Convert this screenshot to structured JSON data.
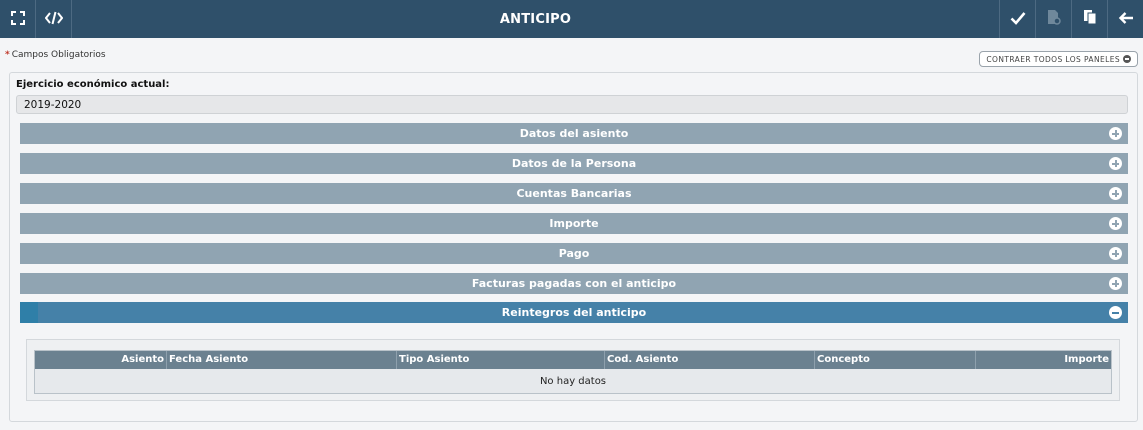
{
  "topbar": {
    "title": "ANTICIPO",
    "left_icons": [
      "fullscreen-icon",
      "code-icon"
    ],
    "right_icons": [
      "check-icon",
      "document-settings-icon",
      "copy-icon",
      "back-arrow-icon"
    ]
  },
  "required_note": "Campos Obligatorios",
  "collapse_all_label": "CONTRAER TODOS LOS PANELES",
  "fiscal_year": {
    "label": "Ejercicio económico actual:",
    "value": "2019-2020"
  },
  "sections": [
    {
      "label": "Datos del asiento",
      "state": "collapsed"
    },
    {
      "label": "Datos de la Persona",
      "state": "collapsed"
    },
    {
      "label": "Cuentas Bancarias",
      "state": "collapsed"
    },
    {
      "label": "Importe",
      "state": "collapsed"
    },
    {
      "label": "Pago",
      "state": "collapsed"
    },
    {
      "label": "Facturas pagadas con el anticipo",
      "state": "collapsed"
    },
    {
      "label": "Reintegros del anticipo",
      "state": "expanded"
    }
  ],
  "reintegros_table": {
    "columns": [
      "Asiento",
      "Fecha Asiento",
      "Tipo Asiento",
      "Cod. Asiento",
      "Concepto",
      "Importe"
    ],
    "empty_text": "No hay datos"
  },
  "colors": {
    "topbar": "#2f506a",
    "section_collapsed": "#90a4b2",
    "section_expanded": "#4581a8",
    "table_header": "#6b8190"
  }
}
